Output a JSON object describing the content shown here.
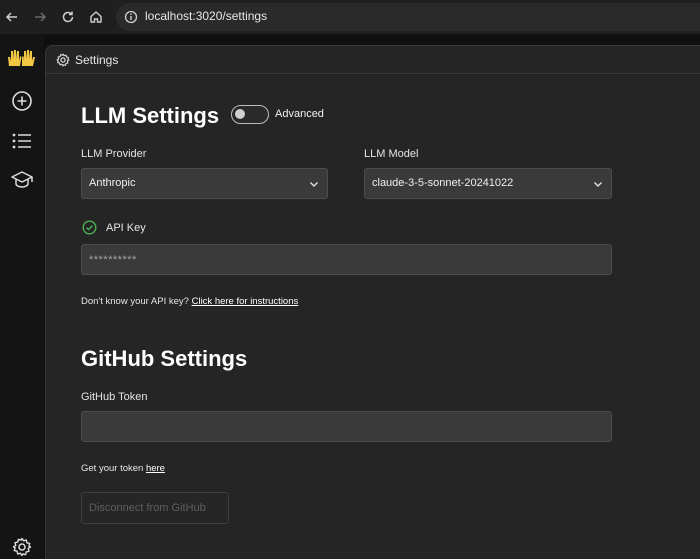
{
  "browser": {
    "url": "localhost:3020/settings",
    "icons": [
      "back-icon",
      "forward-icon",
      "reload-icon",
      "home-icon",
      "site-info-icon"
    ]
  },
  "sidebar": {
    "logo": "👐",
    "items": [
      {
        "name": "new-item",
        "icon": "plus-circle-icon"
      },
      {
        "name": "list",
        "icon": "list-icon"
      },
      {
        "name": "learn",
        "icon": "graduation-cap-icon"
      },
      {
        "name": "settings",
        "icon": "gear-icon"
      }
    ]
  },
  "header": {
    "title": "Settings"
  },
  "llm": {
    "heading": "LLM Settings",
    "advanced_label": "Advanced",
    "advanced_enabled": false,
    "provider_label": "LLM Provider",
    "provider_value": "Anthropic",
    "model_label": "LLM Model",
    "model_value": "claude-3-5-sonnet-20241022",
    "api_key_label": "API Key",
    "api_key_status": "valid",
    "api_key_placeholder": "**********",
    "help_prefix": "Don't know your API key?",
    "help_link": "Click here for instructions"
  },
  "github": {
    "heading": "GitHub Settings",
    "token_label": "GitHub Token",
    "token_value": "",
    "help_prefix": "Get your token",
    "help_link": "here",
    "disconnect_label": "Disconnect from GitHub"
  },
  "colors": {
    "background": "#252525",
    "input": "#3a3a3a",
    "success": "#4caf50"
  }
}
